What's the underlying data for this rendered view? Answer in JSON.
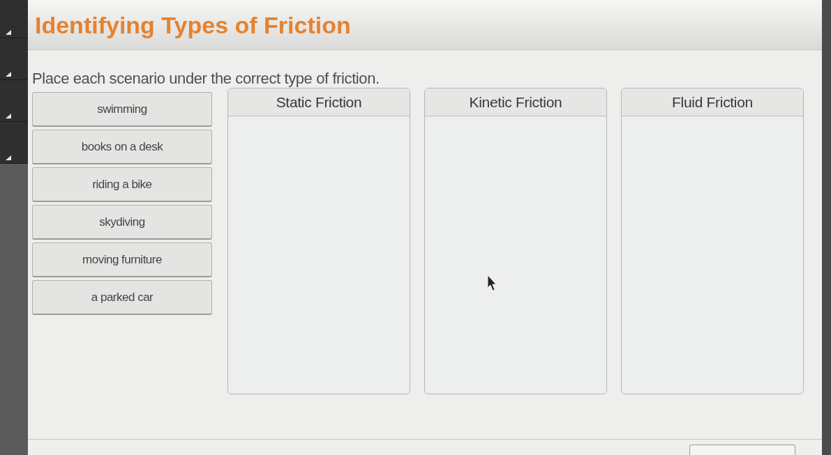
{
  "title": "Identifying Types of Friction",
  "instructions": "Place each scenario under the correct type of friction.",
  "scenarios": [
    "swimming",
    "books on a desk",
    "riding a bike",
    "skydiving",
    "moving furniture",
    "a parked car"
  ],
  "categories": [
    "Static Friction",
    "Kinetic Friction",
    "Fluid Friction"
  ]
}
